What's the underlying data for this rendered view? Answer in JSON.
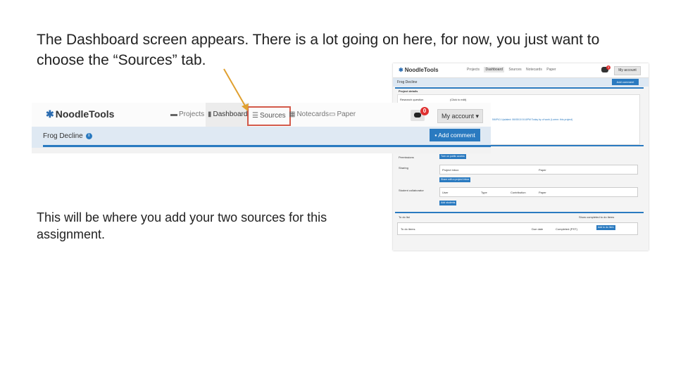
{
  "caption_top": "The Dashboard screen appears.  There is a lot going on here, for now, you just want to choose the “Sources” tab.",
  "caption_bottom": "This will be where you add your two sources for this assignment.",
  "zoom": {
    "logo": "NoodleTools",
    "tabs": [
      "Projects",
      "Dashboard",
      "Sources",
      "Notecards",
      "Paper"
    ],
    "highlighted_tab": "Sources",
    "notification_count": "0",
    "account_label": "My account",
    "project_name": "Frog Decline",
    "add_comment_label": "Add comment"
  },
  "screenshot": {
    "logo": "NoodleTools",
    "tabs": [
      "Projects",
      "Dashboard",
      "Sources",
      "Notecards",
      "Paper"
    ],
    "notification_count": "3",
    "account_label": "My account",
    "project_name": "Frog Decline",
    "add_comment_label": "Add comment",
    "project_details_label": "Project details",
    "research_question_label": "Research question",
    "research_question_value": "(Click to edit)",
    "updated_line": "5/6/P41 Updated: 06/05/10 8:16PM Today by of work (Lorem: this project)",
    "permissions_label": "Permissions",
    "permissions_button": "Turn on public access",
    "sharing_label": "Sharing",
    "sharing_columns": [
      "Project Inbox",
      "Paper"
    ],
    "share_button": "Share with a project inbox",
    "collaborators_label": "Student collaborator",
    "collaborator_columns": [
      "User",
      "Type",
      "Contribution",
      "Paper"
    ],
    "add_students_button": "Add students",
    "todo_label": "To do list",
    "todo_toggle": "Show completed to do items",
    "todo_columns": [
      "To do items",
      "Due date",
      "Completed (PST)"
    ],
    "add_todo_button": "Add to do item"
  },
  "colors": {
    "accent": "#2a7ac0",
    "highlight_border": "#d35a4a",
    "arrow": "#e0a030",
    "badge": "#e03131"
  }
}
